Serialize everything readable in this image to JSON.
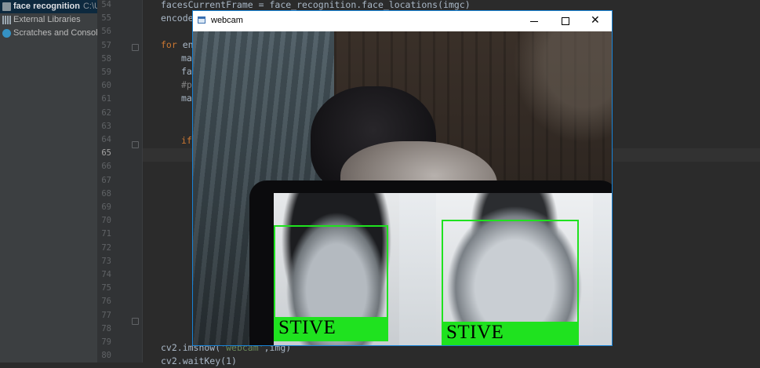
{
  "project_tree": {
    "project_name": "face recognition",
    "project_path": "C:\\Use",
    "items": [
      {
        "label": "External Libraries",
        "icon": "library-icon"
      },
      {
        "label": "Scratches and Consoles",
        "icon": "scratches-icon"
      }
    ]
  },
  "editor": {
    "line_numbers": [
      "54",
      "55",
      "56",
      "57",
      "58",
      "59",
      "60",
      "61",
      "62",
      "63",
      "64",
      "65",
      "66",
      "67",
      "68",
      "69",
      "70",
      "71",
      "72",
      "73",
      "74",
      "75",
      "76",
      "77",
      "78",
      "79",
      "80"
    ],
    "current_line": "65",
    "lines": {
      "l54": "facesCurrentFrame = face_recognition.face_locations(imgc)",
      "l55": "encode",
      "l57_kw": "for",
      "l57_rest": " en",
      "l58": "ma",
      "l59": "fa",
      "l60": "#p",
      "l61": "ma",
      "l64": "if",
      "l79_a": "cv2.imshow(",
      "l79_str": "'webcam'",
      "l79_b": ",img)",
      "l80": "cv2.waitKey(1)"
    }
  },
  "webcam_window": {
    "title": "webcam",
    "buttons": {
      "minimize": "minimize",
      "maximize": "maximize",
      "close": "✕"
    },
    "detections": [
      {
        "name": "STIVE"
      },
      {
        "name": "STIVE"
      }
    ],
    "colors": {
      "box": "#1fe21f",
      "border": "#1883d7"
    }
  }
}
